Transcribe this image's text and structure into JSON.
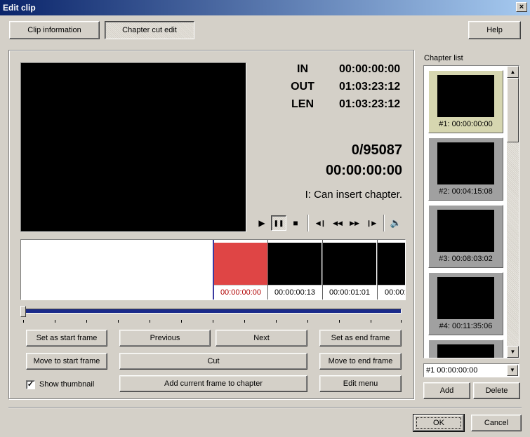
{
  "window": {
    "title": "Edit clip",
    "close_glyph": "×"
  },
  "tabs": {
    "clip_information": "Clip information",
    "chapter_cut_edit": "Chapter cut edit",
    "help": "Help"
  },
  "timecodes": {
    "in_label": "IN",
    "in_value": "00:00:00:00",
    "out_label": "OUT",
    "out_value": "01:03:23:12",
    "len_label": "LEN",
    "len_value": "01:03:23:12"
  },
  "position": {
    "frame_counter": "0/95087",
    "current_time": "00:00:00:00",
    "status": "I: Can insert chapter."
  },
  "transport_icons": {
    "play": "▶",
    "pause": "❚❚",
    "stop": "■",
    "step_back": "◀❙",
    "rewind": "◀◀",
    "forward": "▶▶",
    "step_forward": "❙▶",
    "volume": "🔈"
  },
  "filmstrip": {
    "frames": [
      {
        "time": "00:00:00:00"
      },
      {
        "time": "00:00:00:13"
      },
      {
        "time": "00:00:01:01"
      },
      {
        "time": "00:00:"
      }
    ]
  },
  "buttons": {
    "set_start": "Set as start frame",
    "previous": "Previous",
    "next": "Next",
    "set_end": "Set as end frame",
    "move_start": "Move to start frame",
    "cut": "Cut",
    "move_end": "Move to end frame",
    "add_current": "Add current frame to chapter",
    "edit_menu": "Edit menu",
    "add": "Add",
    "delete": "Delete",
    "ok": "OK",
    "cancel": "Cancel"
  },
  "show_thumbnail": {
    "label": "Show thumbnail",
    "checked_glyph": "✓"
  },
  "chapter_list": {
    "title": "Chapter list",
    "items": [
      {
        "label": "#1: 00:00:00:00"
      },
      {
        "label": "#2: 00:04:15:08"
      },
      {
        "label": "#3: 00:08:03:02"
      },
      {
        "label": "#4: 00:11:35:06"
      }
    ],
    "selected_value": "#1    00:00:00:00",
    "scroll_up": "▲",
    "scroll_down": "▼",
    "combo_arrow": "▼"
  }
}
